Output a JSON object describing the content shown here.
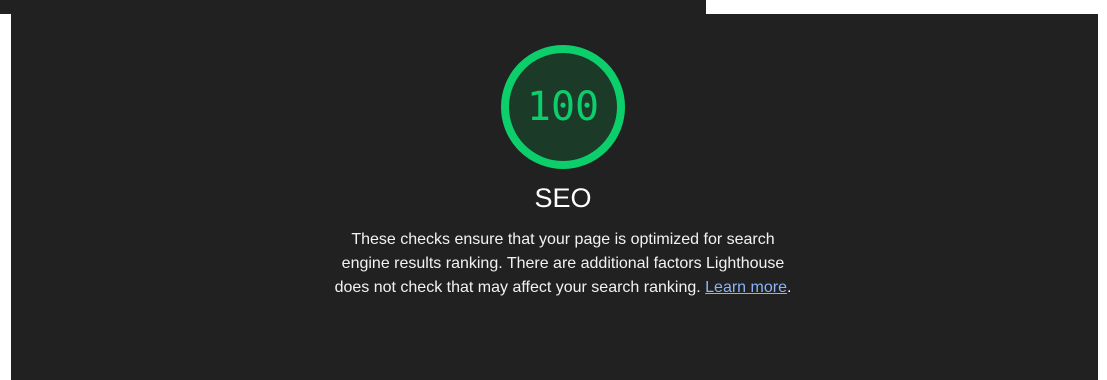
{
  "category": {
    "score": "100",
    "title": "SEO",
    "description": "These checks ensure that your page is optimized for search engine results ranking. There are additional factors Lighthouse does not check that may affect your search ranking.",
    "learn_more_label": "Learn more",
    "trailing_period": "."
  },
  "gauge": {
    "fraction": 1.0,
    "color": "#0cce6b",
    "fill_color": "#1c3a28"
  },
  "theme": {
    "background": "#212121",
    "text": "#ffffff",
    "link": "#8ab4f8"
  }
}
